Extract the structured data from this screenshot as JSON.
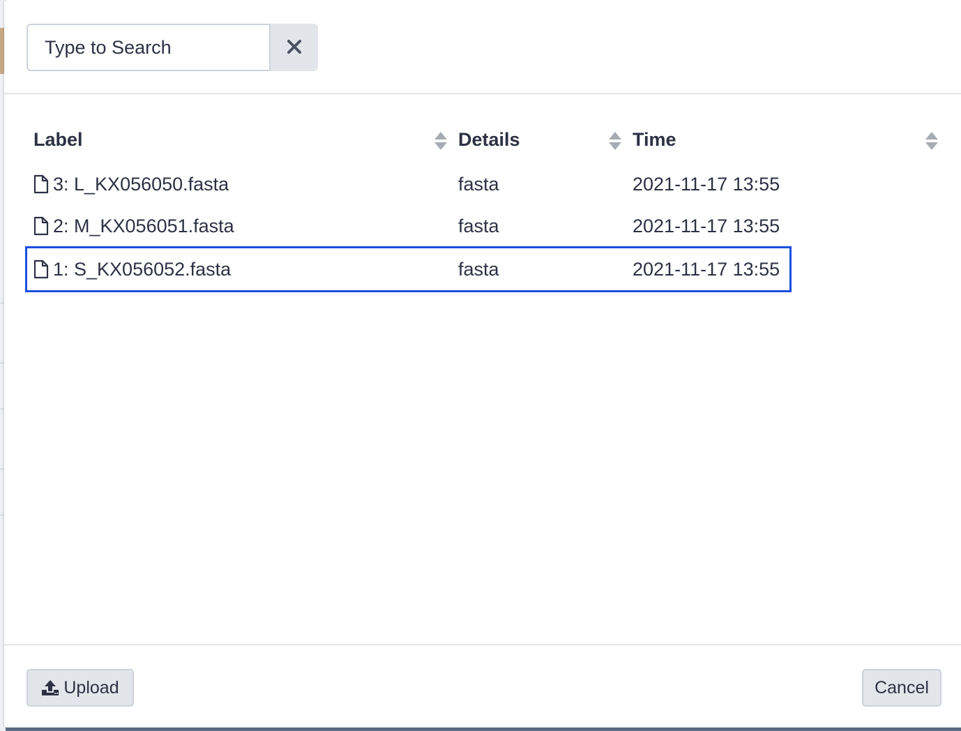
{
  "search": {
    "placeholder": "Type to Search",
    "value": "",
    "clear_icon": "close-icon"
  },
  "table": {
    "columns": [
      {
        "label": "Label",
        "sort_icon": "sort-icon"
      },
      {
        "label": "Details",
        "sort_icon": "sort-icon"
      },
      {
        "label": "Time",
        "sort_icon": "sort-icon"
      }
    ],
    "rows": [
      {
        "icon": "file-icon",
        "label": "3: L_KX056050.fasta",
        "details": "fasta",
        "time": "2021-11-17 13:55",
        "selected": false
      },
      {
        "icon": "file-icon",
        "label": "2: M_KX056051.fasta",
        "details": "fasta",
        "time": "2021-11-17 13:55",
        "selected": false
      },
      {
        "icon": "file-icon",
        "label": "1: S_KX056052.fasta",
        "details": "fasta",
        "time": "2021-11-17 13:55",
        "selected": true
      }
    ]
  },
  "footer": {
    "upload_label": "Upload",
    "upload_icon": "upload-icon",
    "cancel_label": "Cancel"
  },
  "colors": {
    "selection_border": "#1a4fe0",
    "button_bg": "#e2e6ea",
    "text": "#2c3143"
  }
}
